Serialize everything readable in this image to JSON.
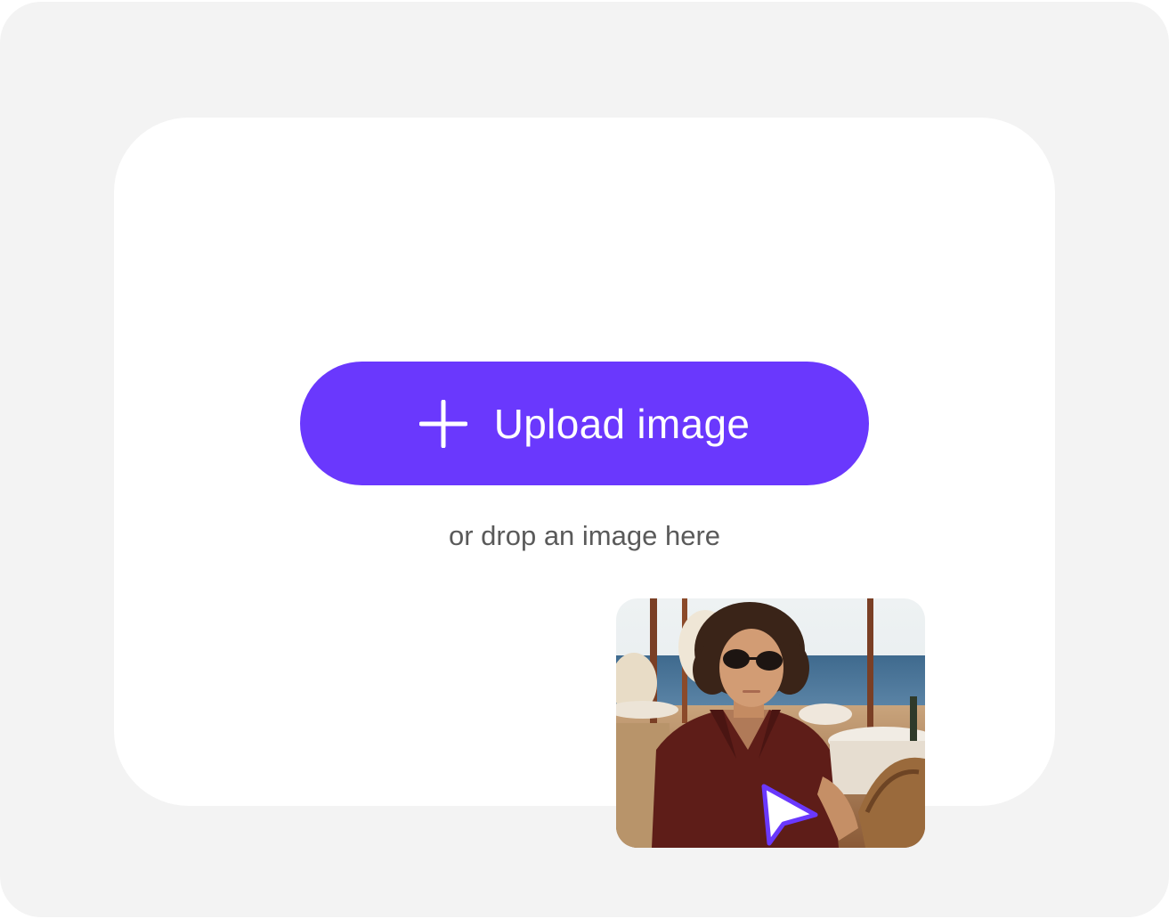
{
  "upload_button": {
    "label": "Upload image",
    "icon": "plus-icon"
  },
  "drop_hint": "or drop an image here",
  "preview": {
    "cursor_icon": "pointer-cursor-icon"
  },
  "colors": {
    "outer_background": "#f3f3f3",
    "panel_background": "#ffffff",
    "accent": "#6a38fd",
    "hint_text": "#5a5a5a"
  }
}
